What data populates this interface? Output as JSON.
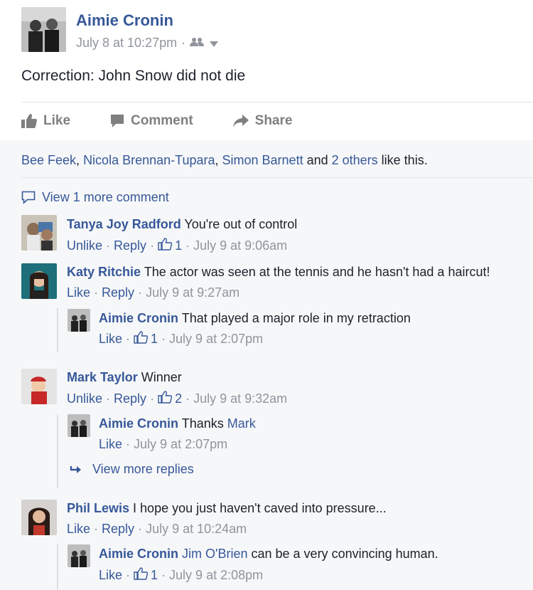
{
  "post": {
    "author": "Aimie Cronin",
    "timestamp": "July 8 at 10:27pm",
    "meta_sep": "·",
    "text": "Correction: John Snow did not die"
  },
  "actions": {
    "like": "Like",
    "comment": "Comment",
    "share": "Share"
  },
  "likes": {
    "names": [
      "Bee Feek",
      "Nicola Brennan-Tupara",
      "Simon Barnett"
    ],
    "sep1": ", ",
    "sep2": ", ",
    "and": " and ",
    "others": "2 others",
    "tail": " like this."
  },
  "view_more_comments": "View 1 more comment",
  "comments": [
    {
      "name": "Tanya Joy Radford",
      "text": "You're out of control",
      "action": "Unlike",
      "reply": "Reply",
      "likes": "1",
      "time": "July 9 at 9:06am"
    },
    {
      "name": "Katy Ritchie",
      "text": "The actor was seen at the tennis and he hasn't had a haircut!",
      "action": "Like",
      "reply": "Reply",
      "time": "July 9 at 9:27am",
      "replies": [
        {
          "name": "Aimie Cronin",
          "text": "That played a major role in my retraction",
          "action": "Like",
          "likes": "1",
          "time": "July 9 at 2:07pm"
        }
      ]
    },
    {
      "name": "Mark Taylor",
      "text": "Winner",
      "action": "Unlike",
      "reply": "Reply",
      "likes": "2",
      "time": "July 9 at 9:32am",
      "replies": [
        {
          "name": "Aimie Cronin",
          "text_prefix": "Thanks ",
          "mention": "Mark",
          "action": "Like",
          "time": "July 9 at 2:07pm"
        }
      ],
      "view_more_replies": "View more replies"
    },
    {
      "name": "Phil Lewis",
      "text": "I hope you just haven't caved into pressure...",
      "action": "Like",
      "reply": "Reply",
      "time": "July 9 at 10:24am",
      "replies": [
        {
          "name": "Aimie Cronin",
          "mention": "Jim O'Brien",
          "text": "can be a very convincing human.",
          "action": "Like",
          "likes": "1",
          "time": "July 9 at 2:08pm"
        }
      ]
    }
  ],
  "sep": "·",
  "icons": {
    "friends": "friends-icon",
    "dropdown": "chevron-down-icon",
    "like": "thumb-up-icon",
    "comment": "comment-icon",
    "share": "share-arrow-icon",
    "reply_arrow": "reply-arrow-icon"
  },
  "colors": {
    "link": "#365899",
    "meta": "#90949c",
    "text": "#1d2129",
    "action": "#7f7f7f",
    "panel": "#f6f7f9"
  }
}
